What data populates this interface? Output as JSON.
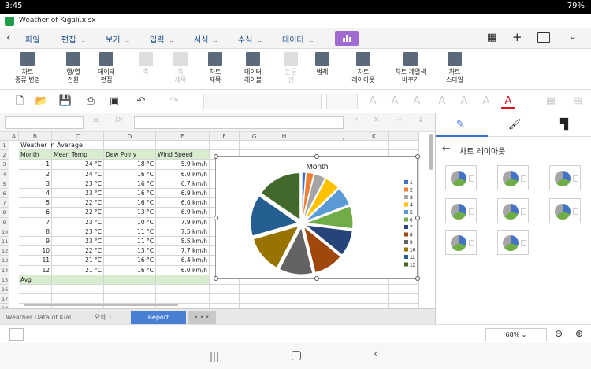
{
  "status": {
    "time": "3:45",
    "battery": "79%"
  },
  "app": {
    "file_title": "Weather of Kigali.xlsx"
  },
  "menu": [
    {
      "label": "파일"
    },
    {
      "label": "편집"
    },
    {
      "label": "보기"
    },
    {
      "label": "입력"
    },
    {
      "label": "서식"
    },
    {
      "label": "수식"
    },
    {
      "label": "데이터"
    }
  ],
  "ribbon": [
    {
      "label": "차트\n종류 변경",
      "dis": false
    },
    {
      "label": "행/열\n전환",
      "dis": false
    },
    {
      "label": "데이터\n편집",
      "dis": false
    },
    {
      "label": "축",
      "dis": true
    },
    {
      "label": "축\n제목",
      "dis": true
    },
    {
      "label": "차트\n제목",
      "dis": false
    },
    {
      "label": "데이터\n레이블",
      "dis": false
    },
    {
      "label": "눈금\n선",
      "dis": true
    },
    {
      "label": "범례",
      "dis": false
    },
    {
      "label": "차트\n레이아웃",
      "dis": false
    },
    {
      "label": "차트 계열색\n바꾸기",
      "dis": false
    },
    {
      "label": "차트\n스타일",
      "dis": false
    }
  ],
  "columns": [
    "A",
    "B",
    "C",
    "D",
    "E",
    "F",
    "G",
    "H",
    "I",
    "J",
    "K",
    "L"
  ],
  "rows": [
    "1",
    "2",
    "3",
    "4",
    "5",
    "6",
    "7",
    "8",
    "9",
    "10",
    "11",
    "12",
    "13",
    "14",
    "15",
    "16",
    "17",
    "18"
  ],
  "sheet": {
    "title": "Weather in Average",
    "headers": [
      "Month",
      "Mean Temp",
      "Dew Poiny",
      "Wind Speed"
    ],
    "data": [
      [
        "1",
        "24 °C",
        "18 °C",
        "5.9 km/h"
      ],
      [
        "2",
        "24 °C",
        "16 °C",
        "6.0 km/h"
      ],
      [
        "3",
        "23 °C",
        "16 °C",
        "6.7 km/h"
      ],
      [
        "4",
        "23 °C",
        "16 °C",
        "6.9 km/h"
      ],
      [
        "5",
        "22 °C",
        "16 °C",
        "6.0 km/h"
      ],
      [
        "6",
        "22 °C",
        "13 °C",
        "6.9 km/h"
      ],
      [
        "7",
        "23 °C",
        "10 °C",
        "7.9 km/h"
      ],
      [
        "8",
        "23 °C",
        "11 °C",
        "7.5 km/h"
      ],
      [
        "9",
        "23 °C",
        "11 °C",
        "8.5 km/h"
      ],
      [
        "10",
        "22 °C",
        "13 °C",
        "7.7 km/h"
      ],
      [
        "11",
        "21 °C",
        "16 °C",
        "6.4 km/h"
      ],
      [
        "12",
        "21 °C",
        "16 °C",
        "6.0 km/h"
      ]
    ],
    "avg_label": "Avg"
  },
  "chart_data": {
    "type": "pie",
    "title": "Month",
    "categories": [
      "1",
      "2",
      "3",
      "4",
      "5",
      "6",
      "7",
      "8",
      "9",
      "10",
      "11",
      "12"
    ],
    "values": [
      1,
      2,
      3,
      4,
      5,
      6,
      7,
      8,
      9,
      10,
      11,
      12
    ],
    "colors": [
      "#4472c4",
      "#ed7d31",
      "#a5a5a5",
      "#ffc000",
      "#5b9bd5",
      "#70ad47",
      "#264478",
      "#9e480e",
      "#636363",
      "#997300",
      "#255e91",
      "#43682b"
    ],
    "legend": "right"
  },
  "tabs": [
    {
      "label": "Weather Data of Kiali"
    },
    {
      "label": "요약 1"
    },
    {
      "label": "Report"
    },
    {
      "label": "• • •"
    }
  ],
  "panel": {
    "title": "차트 레이아웃"
  },
  "zoom": "68%"
}
